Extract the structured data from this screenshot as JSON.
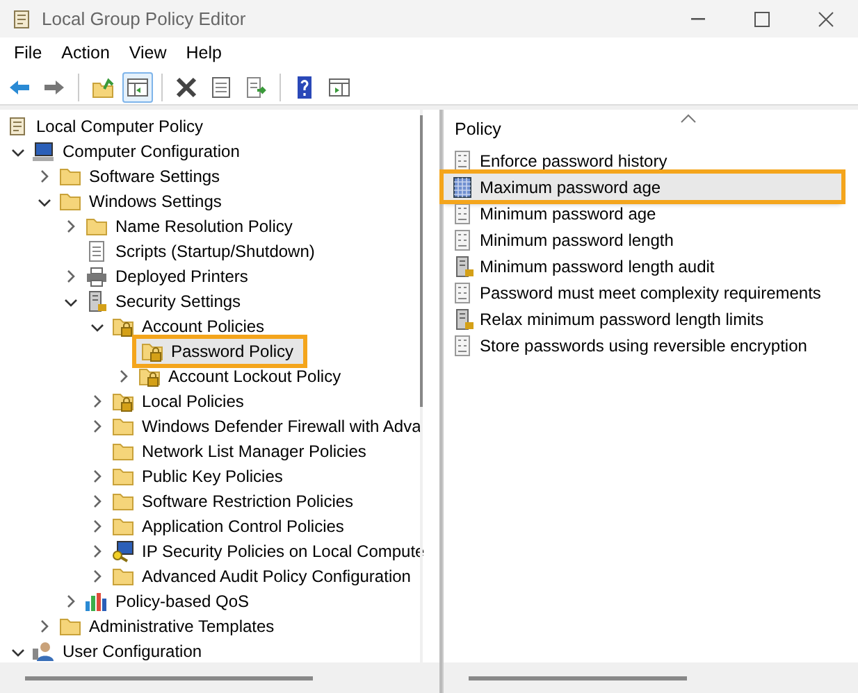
{
  "window": {
    "title": "Local Group Policy Editor"
  },
  "menu": [
    "File",
    "Action",
    "View",
    "Help"
  ],
  "toolbar": [
    {
      "kind": "back",
      "pressed": false
    },
    {
      "kind": "forward",
      "pressed": false
    },
    {
      "kind": "sep"
    },
    {
      "kind": "up",
      "pressed": false
    },
    {
      "kind": "tree",
      "pressed": true
    },
    {
      "kind": "sep"
    },
    {
      "kind": "delete",
      "pressed": false
    },
    {
      "kind": "properties",
      "pressed": false
    },
    {
      "kind": "export",
      "pressed": false
    },
    {
      "kind": "sep"
    },
    {
      "kind": "help",
      "pressed": false
    },
    {
      "kind": "actionpane",
      "pressed": false
    }
  ],
  "tree": [
    {
      "label": "Local Computer Policy",
      "kind": "scroll",
      "selected": false,
      "children": [
        {
          "label": "Computer Configuration",
          "kind": "computer",
          "expanded": true,
          "selected": false,
          "children": [
            {
              "label": "Software Settings",
              "kind": "folder",
              "expanded": false,
              "selected": false
            },
            {
              "label": "Windows Settings",
              "kind": "folder",
              "expanded": true,
              "selected": false,
              "children": [
                {
                  "label": "Name Resolution Policy",
                  "kind": "folder",
                  "expanded": false,
                  "selected": false
                },
                {
                  "label": "Scripts (Startup/Shutdown)",
                  "kind": "script",
                  "selected": false
                },
                {
                  "label": "Deployed Printers",
                  "kind": "printer",
                  "expanded": false,
                  "selected": false
                },
                {
                  "label": "Security Settings",
                  "kind": "server",
                  "expanded": true,
                  "selected": false,
                  "children": [
                    {
                      "label": "Account Policies",
                      "kind": "lockfolder",
                      "expanded": true,
                      "selected": false,
                      "children": [
                        {
                          "label": "Password Policy",
                          "kind": "lockfolder",
                          "selected": true
                        },
                        {
                          "label": "Account Lockout Policy",
                          "kind": "lockfolder",
                          "expanded": false,
                          "selected": false
                        }
                      ]
                    },
                    {
                      "label": "Local Policies",
                      "kind": "lockfolder",
                      "expanded": false,
                      "selected": false
                    },
                    {
                      "label": "Windows Defender Firewall with Adva",
                      "kind": "folder",
                      "expanded": false,
                      "selected": false
                    },
                    {
                      "label": "Network List Manager Policies",
                      "kind": "folder",
                      "selected": false
                    },
                    {
                      "label": "Public Key Policies",
                      "kind": "folder",
                      "expanded": false,
                      "selected": false
                    },
                    {
                      "label": "Software Restriction Policies",
                      "kind": "folder",
                      "expanded": false,
                      "selected": false
                    },
                    {
                      "label": "Application Control Policies",
                      "kind": "folder",
                      "expanded": false,
                      "selected": false
                    },
                    {
                      "label": "IP Security Policies on Local Compute",
                      "kind": "keycomputer",
                      "expanded": false,
                      "selected": false
                    },
                    {
                      "label": "Advanced Audit Policy Configuration",
                      "kind": "folder",
                      "expanded": false,
                      "selected": false
                    }
                  ]
                },
                {
                  "label": "Policy-based QoS",
                  "kind": "chart",
                  "expanded": false,
                  "selected": false
                }
              ]
            },
            {
              "label": "Administrative Templates",
              "kind": "folder",
              "expanded": false,
              "selected": false
            }
          ]
        },
        {
          "label": "User Configuration",
          "kind": "user",
          "expanded": true,
          "selected": false
        }
      ]
    }
  ],
  "list": {
    "column": "Policy",
    "items": [
      {
        "label": "Enforce password history",
        "kind": "policy",
        "selected": false
      },
      {
        "label": "Maximum password age",
        "kind": "checkered",
        "selected": true
      },
      {
        "label": "Minimum password age",
        "kind": "policy",
        "selected": false
      },
      {
        "label": "Minimum password length",
        "kind": "policy",
        "selected": false
      },
      {
        "label": "Minimum password length audit",
        "kind": "server",
        "selected": false
      },
      {
        "label": "Password must meet complexity requirements",
        "kind": "policy",
        "selected": false
      },
      {
        "label": "Relax minimum password length limits",
        "kind": "server",
        "selected": false
      },
      {
        "label": "Store passwords using reversible encryption",
        "kind": "policy",
        "selected": false
      }
    ]
  }
}
